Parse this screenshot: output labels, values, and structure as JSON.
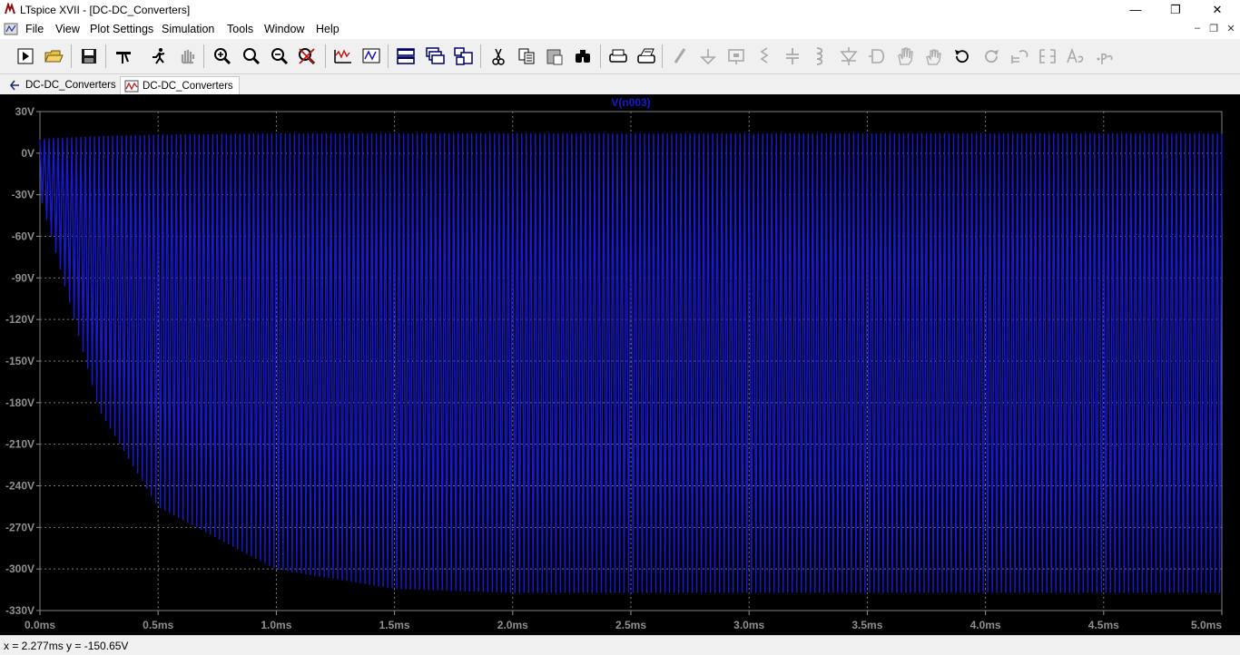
{
  "window": {
    "title": "LTspice XVII - [DC-DC_Converters]",
    "minimize": "—",
    "maximize": "❐",
    "close": "✕"
  },
  "menu": {
    "items": [
      "File",
      "View",
      "Plot Settings",
      "Simulation",
      "Tools",
      "Window",
      "Help"
    ],
    "mdi_minimize": "–",
    "mdi_restore": "❐",
    "mdi_close": "✕"
  },
  "toolbar": {
    "icons": [
      "run-icon",
      "open-icon",
      "save-icon",
      "settings-icon",
      "halt-icon",
      "pan-icon",
      "zoom-in-icon",
      "zoom-full-icon",
      "zoom-out-icon",
      "zoom-cancel-icon",
      "autorange-icon",
      "plot-cursor-icon",
      "tile-horizontal-icon",
      "cascade-icon",
      "tile-vertical-icon",
      "cut-icon",
      "copy-icon",
      "paste-icon",
      "find-icon",
      "print-icon",
      "print-setup-icon",
      "wire-icon",
      "ground-icon",
      "label-icon",
      "resistor-icon",
      "capacitor-icon",
      "inductor-icon",
      "diode-icon",
      "component-icon",
      "move-icon",
      "drag-icon",
      "undo-icon",
      "redo-icon",
      "rotate-icon",
      "mirror-icon",
      "text-icon",
      "spice-directive-icon"
    ]
  },
  "tabs": [
    {
      "label": "DC-DC_Converters",
      "icon": "schematic-icon"
    },
    {
      "label": "DC-DC_Converters",
      "icon": "waveform-icon"
    }
  ],
  "status": {
    "readout": "x = 2.277ms    y = -150.65V"
  },
  "chart_data": {
    "type": "line",
    "title": "V(n003)",
    "xlabel": "",
    "ylabel": "",
    "xlim": [
      0,
      5.0
    ],
    "ylim": [
      -330,
      30
    ],
    "x_ticks": [
      "0.0ms",
      "0.5ms",
      "1.0ms",
      "1.5ms",
      "2.0ms",
      "2.5ms",
      "3.0ms",
      "3.5ms",
      "4.0ms",
      "4.5ms",
      "5.0ms"
    ],
    "y_ticks": [
      "30V",
      "0V",
      "-30V",
      "-60V",
      "-90V",
      "-120V",
      "-150V",
      "-180V",
      "-210V",
      "-240V",
      "-270V",
      "-300V",
      "-330V"
    ],
    "grid": true,
    "series": [
      {
        "name": "V(n003)",
        "color": "#1818d8",
        "envelope_x_ms": [
          0,
          0.25,
          0.5,
          1.0,
          1.5,
          2.0,
          2.5,
          3.0,
          4.0,
          5.0
        ],
        "upper_v": [
          10,
          12,
          13,
          14,
          14,
          14,
          14,
          14,
          14,
          14
        ],
        "lower_v": [
          -30,
          -185,
          -255,
          -300,
          -314,
          -317,
          -317,
          -317,
          -317,
          -317
        ],
        "switching_cycles": 260
      }
    ]
  }
}
